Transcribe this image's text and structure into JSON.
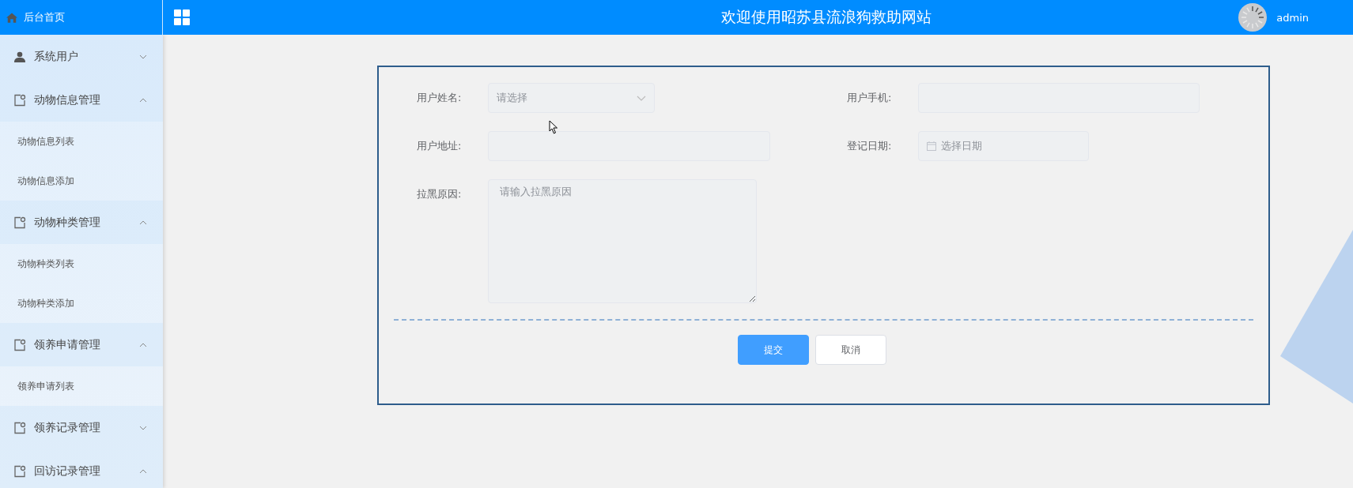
{
  "sidebar": {
    "home": "后台首页",
    "menus": [
      {
        "label": "系统用户",
        "expanded": false
      },
      {
        "label": "动物信息管理",
        "expanded": true,
        "children": [
          {
            "label": "动物信息列表"
          },
          {
            "label": "动物信息添加"
          }
        ]
      },
      {
        "label": "动物种类管理",
        "expanded": true,
        "children": [
          {
            "label": "动物种类列表"
          },
          {
            "label": "动物种类添加"
          }
        ]
      },
      {
        "label": "领养申请管理",
        "expanded": true,
        "children": [
          {
            "label": "领养申请列表"
          }
        ]
      },
      {
        "label": "领养记录管理",
        "expanded": false
      },
      {
        "label": "回访记录管理",
        "expanded": true
      }
    ]
  },
  "header": {
    "title": "欢迎使用昭苏县流浪狗救助网站",
    "user": "admin"
  },
  "form": {
    "fields": [
      {
        "kind": "select",
        "label": "用户姓名:",
        "placeholder": "请选择"
      },
      {
        "kind": "input",
        "label": "用户手机:"
      },
      {
        "kind": "input",
        "label": "用户地址:"
      },
      {
        "kind": "date",
        "label": "登记日期:",
        "placeholder": "选择日期"
      },
      {
        "kind": "textarea",
        "label": "拉黑原因:",
        "placeholder": "请输入拉黑原因"
      }
    ],
    "buttons": [
      {
        "label": "提交",
        "primary": true
      },
      {
        "label": "取消",
        "primary": false
      }
    ]
  }
}
